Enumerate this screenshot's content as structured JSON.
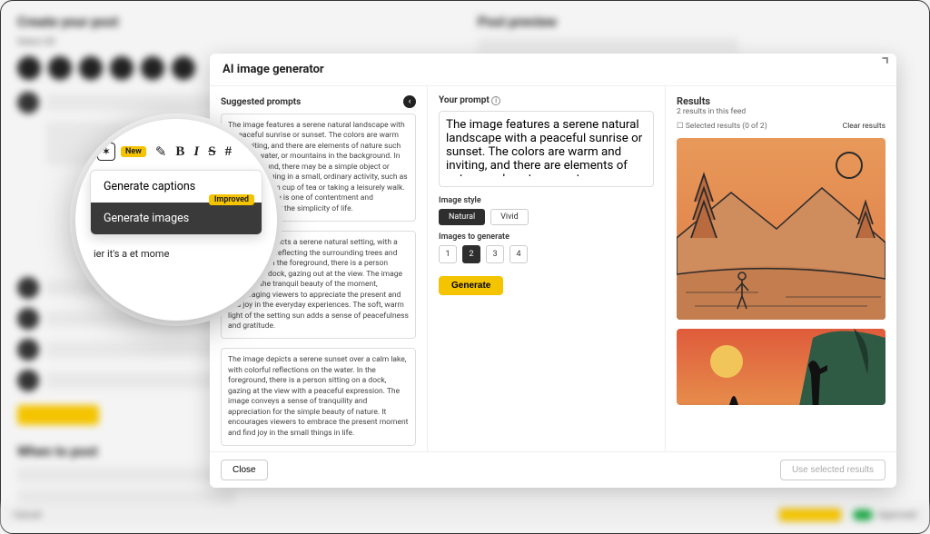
{
  "bg": {
    "create_title": "Create your post",
    "preview_title": "Post preview",
    "select_all": "Select All",
    "when_title": "When to post",
    "cancel": "Cancel",
    "approved": "Approved"
  },
  "modal": {
    "title": "AI image generator",
    "close": "Close",
    "use_results": "Use selected results"
  },
  "suggested": {
    "heading": "Suggested prompts",
    "p1": "The image features a serene natural landscape with a peaceful sunrise or sunset. The colors are warm and inviting, and there are elements of nature such as trees, water, or mountains in the background. In the foreground, there may be a simple object or person engaging in a small, ordinary activity, such as sipping a warm cup of tea or taking a leisurely walk. The overall vibe is one of contentment and appreciation for the simplicity of life.",
    "p2": "The image depicts a serene natural setting, with a peaceful lake reflecting the surrounding trees and mountains. In the foreground, there is a person sitting on a dock, gazing out at the view. The image captures the tranquil beauty of the moment, encouraging viewers to appreciate the present and find joy in the everyday experiences. The soft, warm light of the setting sun adds a sense of peacefulness and gratitude.",
    "p3": "The image depicts a serene sunset over a calm lake, with colorful reflections on the water. In the foreground, there is a person sitting on a dock, gazing at the view with a peaceful expression. The image conveys a sense of tranquility and appreciation for the simple beauty of nature. It encourages viewers to embrace the present moment and find joy in the small things in life."
  },
  "prompt": {
    "heading": "Your prompt",
    "text": "The image features a serene natural landscape with a peaceful sunrise or sunset. The colors are warm and inviting, and there are elements of nature such as trees, water, or mountains in the background. In the foreground, there may be a simple object or person engaging in a small, ordinary activity, such as sipping a warm cup of tea or taking a leisurely walk. The overall vibe",
    "style_label": "Image style",
    "style_natural": "Natural",
    "style_vivid": "Vivid",
    "count_label": "Images to generate",
    "n1": "1",
    "n2": "2",
    "n3": "3",
    "n4": "4",
    "generate": "Generate"
  },
  "results": {
    "heading": "Results",
    "count": "2 results in this feed",
    "selected": "Selected results (0 of 2)",
    "clear": "Clear results"
  },
  "lens": {
    "new": "New",
    "gen_captions": "Generate captions",
    "gen_images": "Generate images",
    "improved": "Improved",
    "caption": "ier it's a                                          et mome"
  }
}
